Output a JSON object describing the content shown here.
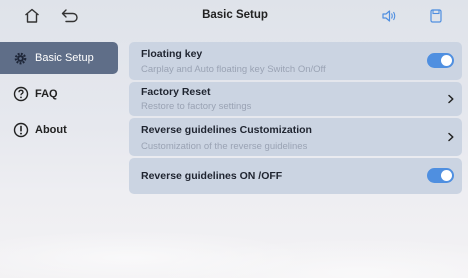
{
  "header": {
    "title": "Basic Setup",
    "icons": [
      "home-icon",
      "back-icon",
      "volume-icon",
      "save-icon"
    ],
    "accent_color": "#4f8fe0"
  },
  "sidebar": {
    "items": [
      {
        "label": "Basic Setup",
        "icon": "gear-icon",
        "active": true
      },
      {
        "label": "FAQ",
        "icon": "question-icon",
        "active": false
      },
      {
        "label": "About",
        "icon": "info-icon",
        "active": false
      }
    ],
    "active_color": "#5f6e88"
  },
  "settings": {
    "rows": [
      {
        "title": "Floating key",
        "subtitle": "Carplay and Auto floating key Switch On/Off",
        "control": "toggle",
        "state": "on"
      },
      {
        "title": "Factory Reset",
        "subtitle": "Restore to factory settings",
        "control": "chevron"
      },
      {
        "title": "Reverse guidelines Customization",
        "subtitle": "Customization of the reverse guidelines",
        "control": "chevron"
      },
      {
        "title": "Reverse guidelines ON /OFF",
        "control": "toggle",
        "state": "on"
      }
    ],
    "row_color": "#cbd4e2"
  }
}
